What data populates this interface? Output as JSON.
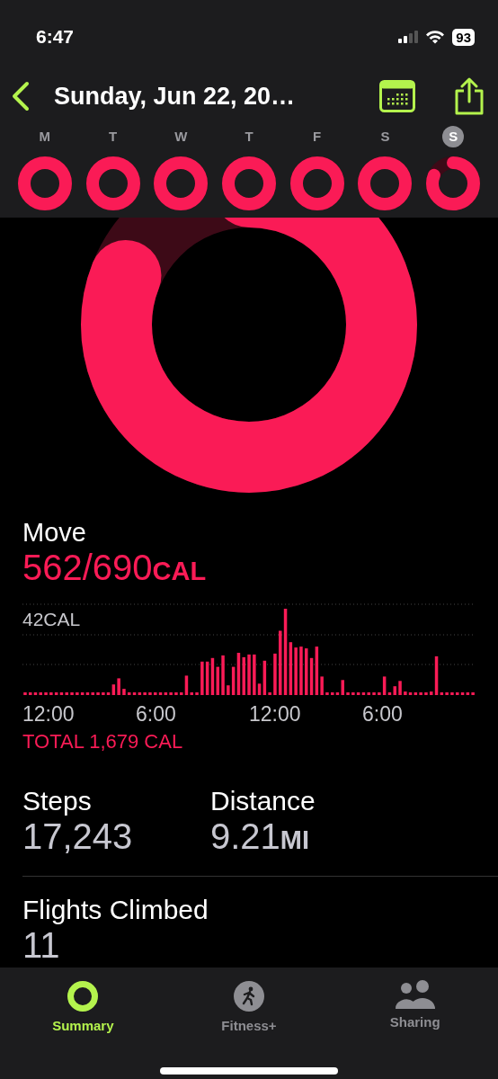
{
  "status_bar": {
    "time": "6:47",
    "battery": "93"
  },
  "header": {
    "title": "Sunday, Jun 22, 20…"
  },
  "week": [
    {
      "letter": "M",
      "selected": false,
      "goal_met": true
    },
    {
      "letter": "T",
      "selected": false,
      "goal_met": true
    },
    {
      "letter": "W",
      "selected": false,
      "goal_met": true
    },
    {
      "letter": "T",
      "selected": false,
      "goal_met": true
    },
    {
      "letter": "F",
      "selected": false,
      "goal_met": true
    },
    {
      "letter": "S",
      "selected": false,
      "goal_met": true
    },
    {
      "letter": "S",
      "selected": true,
      "goal_met": false
    }
  ],
  "move": {
    "label": "Move",
    "value": "562/690",
    "unit": "CAL"
  },
  "chart": {
    "y_label": "42CAL",
    "x_labels": [
      "12:00",
      "6:00",
      "12:00",
      "6:00"
    ],
    "total": "TOTAL 1,679 CAL"
  },
  "stats": [
    {
      "label": "Steps",
      "value": "17,243"
    },
    {
      "label": "Distance",
      "value": "9.21",
      "unit": "MI"
    },
    {
      "label": "Flights Climbed",
      "value": "11"
    }
  ],
  "tab_bar": [
    {
      "label": "Summary",
      "kind": "summary",
      "selected": true
    },
    {
      "label": "Fitness+",
      "kind": "fitness",
      "selected": false
    },
    {
      "label": "Sharing",
      "kind": "sharing",
      "selected": false
    }
  ]
}
